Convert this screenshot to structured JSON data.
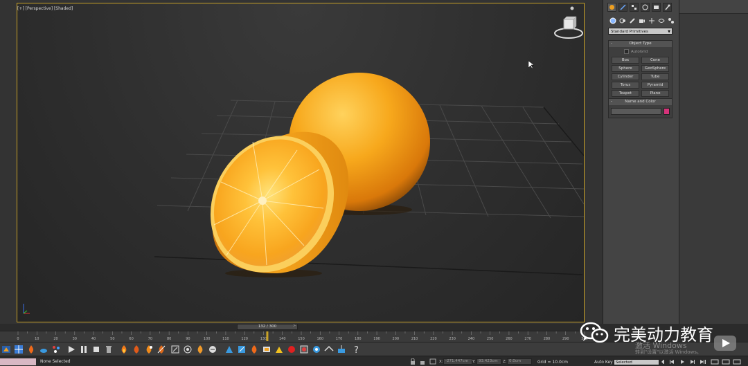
{
  "viewport": {
    "label": "[+] [Perspective] [Shaded]"
  },
  "command_panel": {
    "dropdown_value": "Standard Primitives",
    "object_type_header": "Object Type",
    "autogrid_label": "AutoGrid",
    "primitives": [
      "Box",
      "Cone",
      "Sphere",
      "GeoSphere",
      "Cylinder",
      "Tube",
      "Torus",
      "Pyramid",
      "Teapot",
      "Plane"
    ],
    "name_color_header": "Name and Color",
    "object_color": "#d6337a"
  },
  "timeline": {
    "slider_label": "132 / 300",
    "current_frame": 132,
    "total_frames": 300,
    "ticks": [
      "0",
      "5",
      "10",
      "15",
      "20",
      "25",
      "30",
      "35",
      "40",
      "45",
      "50",
      "55",
      "60",
      "65",
      "70",
      "75",
      "80",
      "85",
      "90",
      "95",
      "100",
      "105",
      "110",
      "115",
      "120",
      "125",
      "130",
      "135",
      "140",
      "145",
      "150",
      "155",
      "160",
      "165",
      "170",
      "175",
      "180",
      "185",
      "190",
      "195",
      "200",
      "205",
      "210",
      "215",
      "220",
      "225",
      "230",
      "235",
      "240",
      "245",
      "250",
      "255",
      "260",
      "265",
      "270",
      "275",
      "280",
      "285",
      "290",
      "295",
      "300"
    ]
  },
  "status": {
    "selection_text": "None Selected",
    "x_label": "X:",
    "x_value": "-271.447cm",
    "y_label": "Y:",
    "y_value": "93.423cm",
    "z_label": "Z:",
    "z_value": "0.0cm",
    "grid_text": "Grid = 10.0cm",
    "autokey_label": "Auto Key",
    "selected_dropdown": "Selected"
  },
  "watermark": {
    "brand_text": "完美动力教育",
    "windows_activate": "激活 Windows",
    "windows_activate_sub": "转到\"设置\"以激活 Windows。"
  },
  "colors": {
    "viewport_border": "#c9a227",
    "orange": "#f5a623",
    "accent_pink": "#d6337a"
  }
}
